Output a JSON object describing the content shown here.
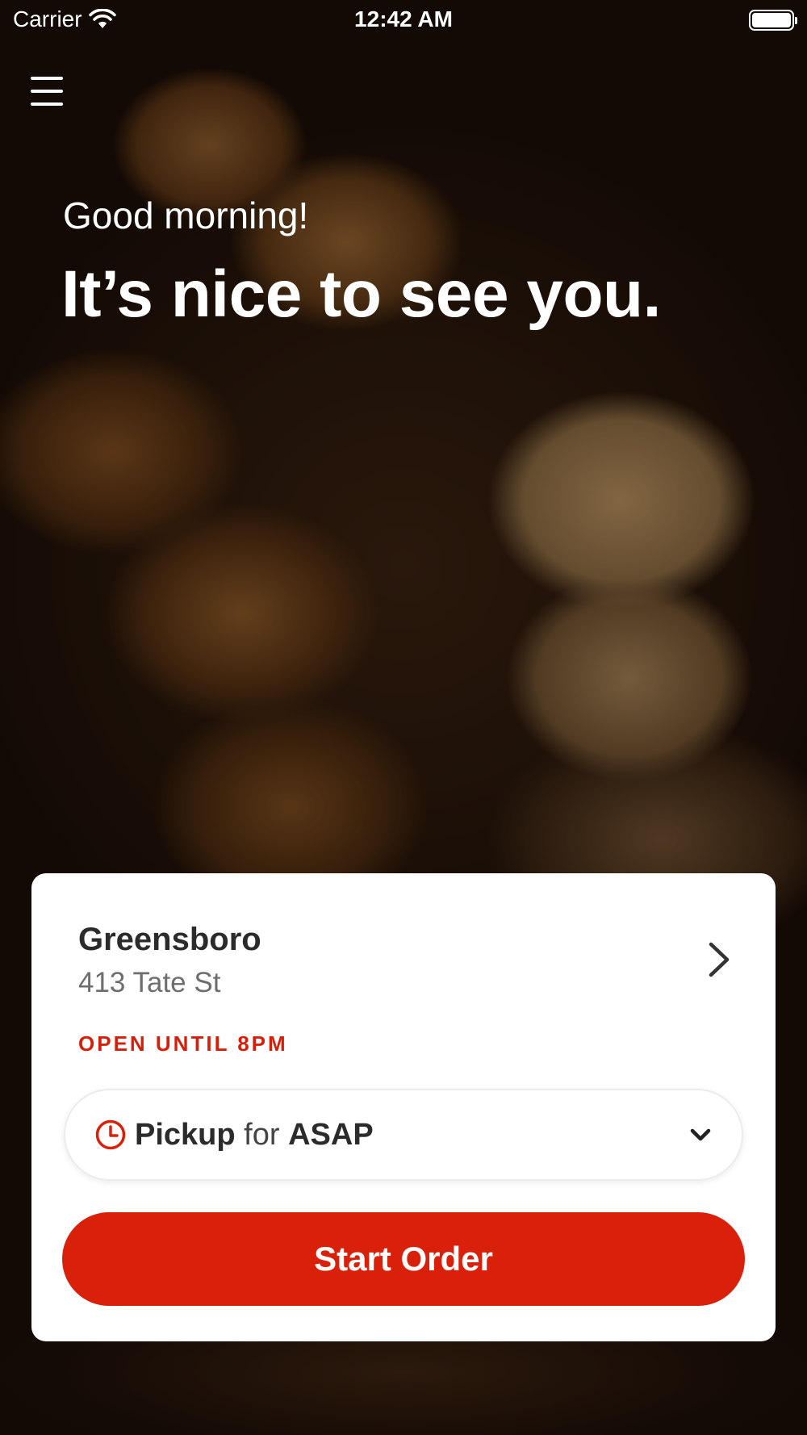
{
  "status_bar": {
    "carrier": "Carrier",
    "time": "12:42 AM"
  },
  "header": {
    "menu_icon": "hamburger-menu-icon",
    "greeting": "Good morning!",
    "headline": "It’s nice to see you."
  },
  "location_card": {
    "name": "Greensboro",
    "address": "413 Tate St",
    "open_status": "OPEN UNTIL 8PM",
    "order_type": "Pickup",
    "order_connector": "for",
    "order_time": "ASAP",
    "start_order_label": "Start Order"
  },
  "colors": {
    "accent": "#d9200b",
    "status_text": "#d61f0a",
    "card_background": "#ffffff"
  }
}
